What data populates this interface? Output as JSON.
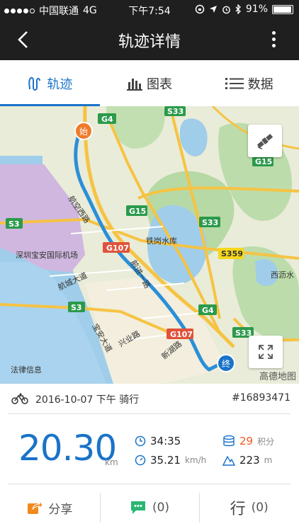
{
  "status_bar": {
    "carrier": "中国联通",
    "network": "4G",
    "time": "下午7:54",
    "battery": "91%",
    "signal_bars": 4,
    "signal_total": 5
  },
  "nav": {
    "title": "轨迹详情"
  },
  "tabs": [
    {
      "label": "轨迹",
      "icon": "route-icon",
      "active": true
    },
    {
      "label": "图表",
      "icon": "bar-chart-icon",
      "active": false
    },
    {
      "label": "数据",
      "icon": "list-icon",
      "active": false
    }
  ],
  "map": {
    "start_label": "始",
    "end_label": "终",
    "watermark": "高德地图",
    "labels": {
      "airport": "深圳宝安国际机场",
      "reservoir": "铁岗水库",
      "xili": "西沥水",
      "hangcheng": "航城大道",
      "yeye": "兴业路",
      "baoan_road": "宝安大道",
      "fazhan": "法律信息",
      "qianjin": "前进一路",
      "xinhu": "新湖路",
      "hangkong": "航空西路"
    },
    "shields": [
      "G4",
      "S33",
      "S33",
      "G15",
      "G15",
      "S3",
      "S33",
      "S359",
      "G107",
      "S3",
      "G4",
      "G107",
      "S33"
    ]
  },
  "activity": {
    "date": "2016-10-07 下午",
    "type": "骑行",
    "id": "#16893471",
    "distance": "20.30",
    "distance_unit": "km",
    "duration": "34:35",
    "speed": "35.21",
    "speed_unit": "km/h",
    "points": "29",
    "points_unit": "积分",
    "elevation": "223",
    "elevation_unit": "m"
  },
  "actions": {
    "share": "分享",
    "comments": "(0)",
    "rides": "(0)",
    "rides_glyph": "行"
  },
  "colors": {
    "accent": "#1a73c8",
    "route": "#2b8fd8",
    "start": "#f07a2a",
    "end": "#1a73c8",
    "points": "#f05a24",
    "share": "#f08a1e",
    "comment": "#2bb673"
  }
}
